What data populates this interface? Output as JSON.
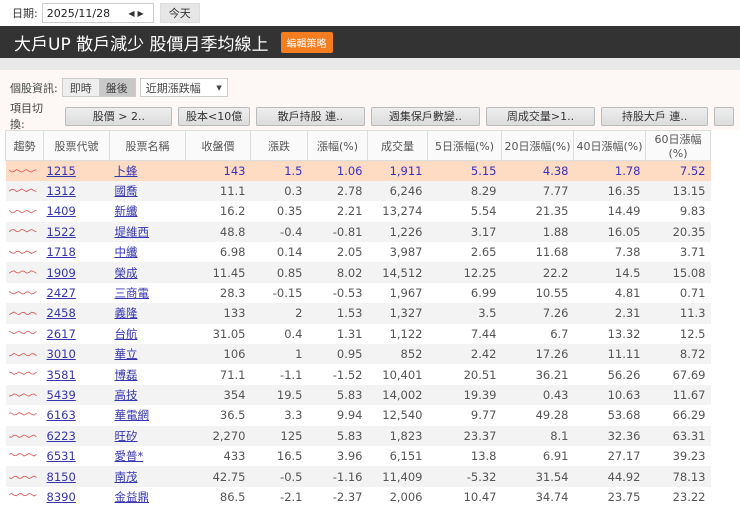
{
  "date": {
    "label": "日期:",
    "value": "2025/11/28",
    "today": "今天"
  },
  "title": {
    "text": "大戶UP 散戶減少 股價月季均線上",
    "edit": "編輯策略"
  },
  "info": {
    "label": "個股資訊:",
    "realtime": "即時",
    "after": "盤後",
    "select": "近期漲跌幅"
  },
  "switch": {
    "label": "項目切換:",
    "items": [
      "股價 > 2..",
      "股本<10億",
      "散戶持股 連..",
      "週集保戶數變..",
      "周成交量>1..",
      "持股大戶 連.."
    ]
  },
  "columns": [
    "趨勢",
    "股票代號",
    "股票名稱",
    "收盤價",
    "漲跌",
    "漲幅(%)",
    "成交量",
    "5日漲幅(%)",
    "20日漲幅(%)",
    "40日漲幅(%)",
    "60日漲幅(%)"
  ],
  "rows": [
    [
      "1215",
      "卜蜂",
      "143",
      "1.5",
      "1.06",
      "1,911",
      "5.15",
      "4.38",
      "1.78",
      "7.52"
    ],
    [
      "1312",
      "國喬",
      "11.1",
      "0.3",
      "2.78",
      "6,246",
      "8.29",
      "7.77",
      "16.35",
      "13.15"
    ],
    [
      "1409",
      "新纖",
      "16.2",
      "0.35",
      "2.21",
      "13,274",
      "5.54",
      "21.35",
      "14.49",
      "9.83"
    ],
    [
      "1522",
      "堤維西",
      "48.8",
      "-0.4",
      "-0.81",
      "1,226",
      "3.17",
      "1.88",
      "16.05",
      "20.35"
    ],
    [
      "1718",
      "中纖",
      "6.98",
      "0.14",
      "2.05",
      "3,987",
      "2.65",
      "11.68",
      "7.38",
      "3.71"
    ],
    [
      "1909",
      "榮成",
      "11.45",
      "0.85",
      "8.02",
      "14,512",
      "12.25",
      "22.2",
      "14.5",
      "15.08"
    ],
    [
      "2427",
      "三商電",
      "28.3",
      "-0.15",
      "-0.53",
      "1,967",
      "6.99",
      "10.55",
      "4.81",
      "0.71"
    ],
    [
      "2458",
      "義隆",
      "133",
      "2",
      "1.53",
      "1,327",
      "3.5",
      "7.26",
      "2.31",
      "11.3"
    ],
    [
      "2617",
      "台航",
      "31.05",
      "0.4",
      "1.31",
      "1,122",
      "7.44",
      "6.7",
      "13.32",
      "12.5"
    ],
    [
      "3010",
      "華立",
      "106",
      "1",
      "0.95",
      "852",
      "2.42",
      "17.26",
      "11.11",
      "8.72"
    ],
    [
      "3581",
      "博磊",
      "71.1",
      "-1.1",
      "-1.52",
      "10,401",
      "20.51",
      "36.21",
      "56.26",
      "67.69"
    ],
    [
      "5439",
      "高技",
      "354",
      "19.5",
      "5.83",
      "14,002",
      "19.39",
      "0.43",
      "10.63",
      "11.67"
    ],
    [
      "6163",
      "華電網",
      "36.5",
      "3.3",
      "9.94",
      "12,540",
      "9.77",
      "49.28",
      "53.68",
      "66.29"
    ],
    [
      "6223",
      "旺矽",
      "2,270",
      "125",
      "5.83",
      "1,823",
      "23.37",
      "8.1",
      "32.36",
      "63.31"
    ],
    [
      "6531",
      "愛普*",
      "433",
      "16.5",
      "3.96",
      "6,151",
      "13.8",
      "6.91",
      "27.17",
      "39.23"
    ],
    [
      "8150",
      "南茂",
      "42.75",
      "-0.5",
      "-1.16",
      "11,409",
      "-5.32",
      "31.54",
      "44.92",
      "78.13"
    ],
    [
      "8390",
      "金益鼎",
      "86.5",
      "-2.1",
      "-2.37",
      "2,006",
      "10.47",
      "34.74",
      "23.75",
      "23.22"
    ]
  ]
}
